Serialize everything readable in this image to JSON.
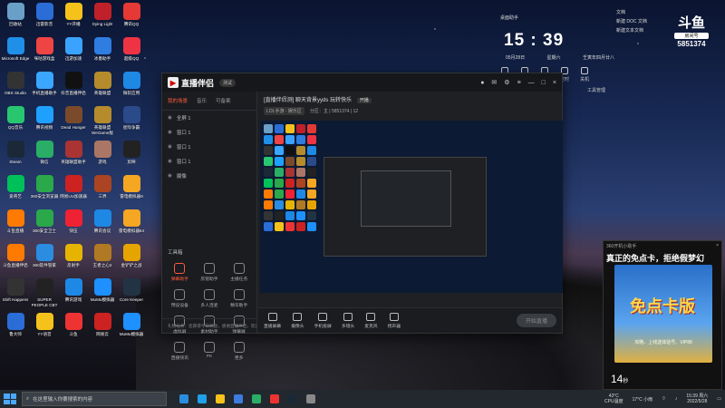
{
  "desktop_icons": [
    {
      "label": "回收站",
      "icon": "recycle-bin-icon",
      "color": "#6aa0c8"
    },
    {
      "label": "迅雷影音",
      "icon": "media-icon",
      "color": "#2a6dd6"
    },
    {
      "label": "YY开播",
      "icon": "yy-icon",
      "color": "#f4c21a"
    },
    {
      "label": "Dying Light",
      "icon": "game-icon",
      "color": "#c0202a"
    },
    {
      "label": "腾讯QQ",
      "icon": "qq-icon",
      "color": "#e53935"
    },
    {
      "label": "Microsoft Edge",
      "icon": "edge-icon",
      "color": "#1f8fe8"
    },
    {
      "label": "咪咕游戏盒",
      "icon": "migu-icon",
      "color": "#e44"
    },
    {
      "label": "迅游加速",
      "icon": "accel-icon",
      "color": "#3aa3ff"
    },
    {
      "label": "冰墨助手",
      "icon": "tool-icon",
      "color": "#2e7de0"
    },
    {
      "label": "超级QQ",
      "icon": "qq-icon",
      "color": "#e34"
    },
    {
      "label": "OBS Studio",
      "icon": "obs-icon",
      "color": "#333"
    },
    {
      "label": "手机直播助手",
      "icon": "phone-icon",
      "color": "#3aa6ff"
    },
    {
      "label": "抖音直播伴侣",
      "icon": "tiktok-icon",
      "color": "#111"
    },
    {
      "label": "英雄联盟",
      "icon": "lol-icon",
      "color": "#b58b2c"
    },
    {
      "label": "微软应用",
      "icon": "store-icon",
      "color": "#1e88e5"
    },
    {
      "label": "QQ音乐",
      "icon": "music-icon",
      "color": "#28c76f"
    },
    {
      "label": "腾讯视频",
      "icon": "video-icon",
      "color": "#1ea0ff"
    },
    {
      "label": "Dead Hunger",
      "icon": "game-icon",
      "color": "#7a4a2a"
    },
    {
      "label": "英雄联盟 WeGame版",
      "icon": "lol-icon",
      "color": "#b58b2c"
    },
    {
      "label": "星际争霸",
      "icon": "game-icon",
      "color": "#2b4a8a"
    },
    {
      "label": "Steam",
      "icon": "steam-icon",
      "color": "#1b2838"
    },
    {
      "label": "微信",
      "icon": "wechat-icon",
      "color": "#2aae67"
    },
    {
      "label": "英雄联盟助手",
      "icon": "lol-icon",
      "color": "#a33"
    },
    {
      "label": "游戏",
      "icon": "game-icon",
      "color": "#a76"
    },
    {
      "label": "剪映",
      "icon": "edit-icon",
      "color": "#222"
    },
    {
      "label": "爱奇艺",
      "icon": "iqiyi-icon",
      "color": "#00c05a"
    },
    {
      "label": "360安全浏览器",
      "icon": "360-icon",
      "color": "#2aa84a"
    },
    {
      "label": "网易UU加速器",
      "icon": "uu-icon",
      "color": "#c22"
    },
    {
      "label": "三界",
      "icon": "game-icon",
      "color": "#a42"
    },
    {
      "label": "雷电模拟器9",
      "icon": "ld-icon",
      "color": "#f5a623"
    },
    {
      "label": "斗鱼直播",
      "icon": "douyu-icon",
      "color": "#ff7a00"
    },
    {
      "label": "360安全卫士",
      "icon": "360-icon",
      "color": "#2aa84a"
    },
    {
      "label": "快压",
      "icon": "zip-icon",
      "color": "#e23"
    },
    {
      "label": "腾讯会议",
      "icon": "meeting-icon",
      "color": "#1e88e5"
    },
    {
      "label": "雷电模拟器64",
      "icon": "ld-icon",
      "color": "#f5a623"
    },
    {
      "label": "斗鱼直播伴侣",
      "icon": "douyu-icon",
      "color": "#ff7a00"
    },
    {
      "label": "360软件管家",
      "icon": "360-icon",
      "color": "#2a8de0"
    },
    {
      "label": "反射手",
      "icon": "game-icon",
      "color": "#e6b400"
    },
    {
      "label": "王者之心2",
      "icon": "game-icon",
      "color": "#b07a24"
    },
    {
      "label": "金铲铲之战",
      "icon": "game-icon",
      "color": "#e6a400"
    },
    {
      "label": "Shift Happens",
      "icon": "game-icon",
      "color": "#333"
    },
    {
      "label": "SUPER PEOPLE CBT",
      "icon": "game-icon",
      "color": "#222"
    },
    {
      "label": "腾讯游戏",
      "icon": "game-icon",
      "color": "#1e88e5"
    },
    {
      "label": "MuMu模拟器",
      "icon": "mumu-icon",
      "color": "#1e90ff"
    },
    {
      "label": "Core Keeper",
      "icon": "game-icon",
      "color": "#234"
    },
    {
      "label": "鲁大师",
      "icon": "ludashi-icon",
      "color": "#2a6dd6"
    },
    {
      "label": "YY语音",
      "icon": "yy-icon",
      "color": "#f4c21a"
    },
    {
      "label": "斗鱼",
      "icon": "douyu-icon",
      "color": "#e33"
    },
    {
      "label": "网易云",
      "icon": "netease-icon",
      "color": "#c22"
    },
    {
      "label": "MuMu模拟器",
      "icon": "mumu-icon",
      "color": "#1e90ff"
    }
  ],
  "app": {
    "name": "直播伴侣",
    "version": "测试",
    "left_tabs": [
      "我的场景",
      "音乐",
      "可备案"
    ],
    "scenes": [
      "全屏 1",
      "窗口 1",
      "窗口 1",
      "窗口 1",
      "摄像"
    ],
    "tools_title": "工具箱",
    "tools": [
      "弹幕助手",
      "房管助手",
      "主播任务",
      "预设设备",
      "多人连麦",
      "精华助手",
      "虚拟屏",
      "素材助手",
      "弹幕屏",
      "直播快讯",
      "PK",
      "更多"
    ],
    "notice": "礼物任务：您获得今日奖励，感谢直播伴侣，欢迎体验",
    "room_title": "[直播伴侣测] 聊天背景yyds 玩转快乐",
    "room_tag": "开播",
    "category": "LOL手游 · 娱乐区",
    "room_meta": "分区：主 | 5851374 | 12",
    "bottom_tools": [
      "直播屏幕",
      "摄像头",
      "手机投屏",
      "多镜头",
      "麦克风",
      "扬声器"
    ],
    "golive": "开始直播"
  },
  "widgets": {
    "date_label": "桌面助手",
    "time": "15 : 39",
    "date": "05月28日",
    "weekday": "星期六",
    "lunar": "壬寅年四月廿八",
    "mini": [
      "桌面",
      "记录",
      "应用",
      "定时",
      "关机"
    ],
    "mini_more": "工具管理",
    "docs": [
      "文档",
      "新建 DOC 文档",
      "新建文本文档"
    ],
    "douyu_logo": "斗鱼",
    "douyu_sub": "房间号",
    "room_id": "5851374"
  },
  "ad": {
    "source": "360开机小助手",
    "close": "×",
    "title": "真正的免点卡，拒绝假梦幻",
    "game": "免点卡版",
    "promo": "攻略、上线送体验号、VIP88",
    "countdown": "14",
    "unit": "秒"
  },
  "taskbar": {
    "search_placeholder": "在这里输入你要搜索的内容",
    "cpu_temp": "43°C",
    "cpu_label": "CPU温度",
    "weather": "17°C 小雨",
    "time": "15:39 周六",
    "date": "2022/5/28"
  }
}
